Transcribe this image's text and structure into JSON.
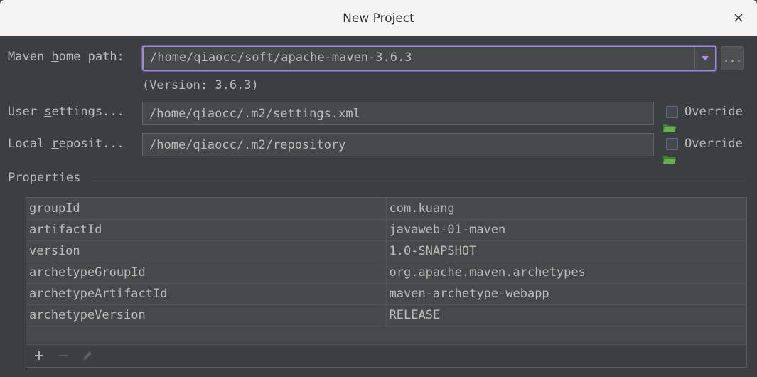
{
  "window": {
    "title": "New Project"
  },
  "maven": {
    "home_label_pre": "Maven ",
    "home_label_u": "h",
    "home_label_post": "ome path:",
    "home_value": "/home/qiaocc/soft/apache-maven-3.6.3",
    "browse_label": "...",
    "version_note": "(Version: 3.6.3)"
  },
  "user_settings": {
    "label_pre": "User ",
    "label_u": "s",
    "label_post": "ettings...",
    "value": "/home/qiaocc/.m2/settings.xml",
    "override_label": "Override",
    "override_checked": false
  },
  "local_repo": {
    "label_pre": "Local ",
    "label_u": "r",
    "label_post": "eposit...",
    "value": "/home/qiaocc/.m2/repository",
    "override_label": "Override",
    "override_checked": false
  },
  "properties": {
    "title": "Properties",
    "rows": [
      {
        "key": "groupId",
        "value": "com.kuang"
      },
      {
        "key": "artifactId",
        "value": "javaweb-01-maven"
      },
      {
        "key": "version",
        "value": "1.0-SNAPSHOT"
      },
      {
        "key": "archetypeGroupId",
        "value": "org.apache.maven.archetypes"
      },
      {
        "key": "archetypeArtifactId",
        "value": "maven-archetype-webapp"
      },
      {
        "key": "archetypeVersion",
        "value": "RELEASE"
      }
    ],
    "toolbar": [
      "add-icon",
      "remove-icon",
      "edit-icon"
    ]
  },
  "colors": {
    "background": "#3c3f41",
    "field": "#45494a",
    "focus_border": "#a08ad6",
    "folder_icon": "#5c9a4d",
    "text": "#bbbbbb"
  }
}
